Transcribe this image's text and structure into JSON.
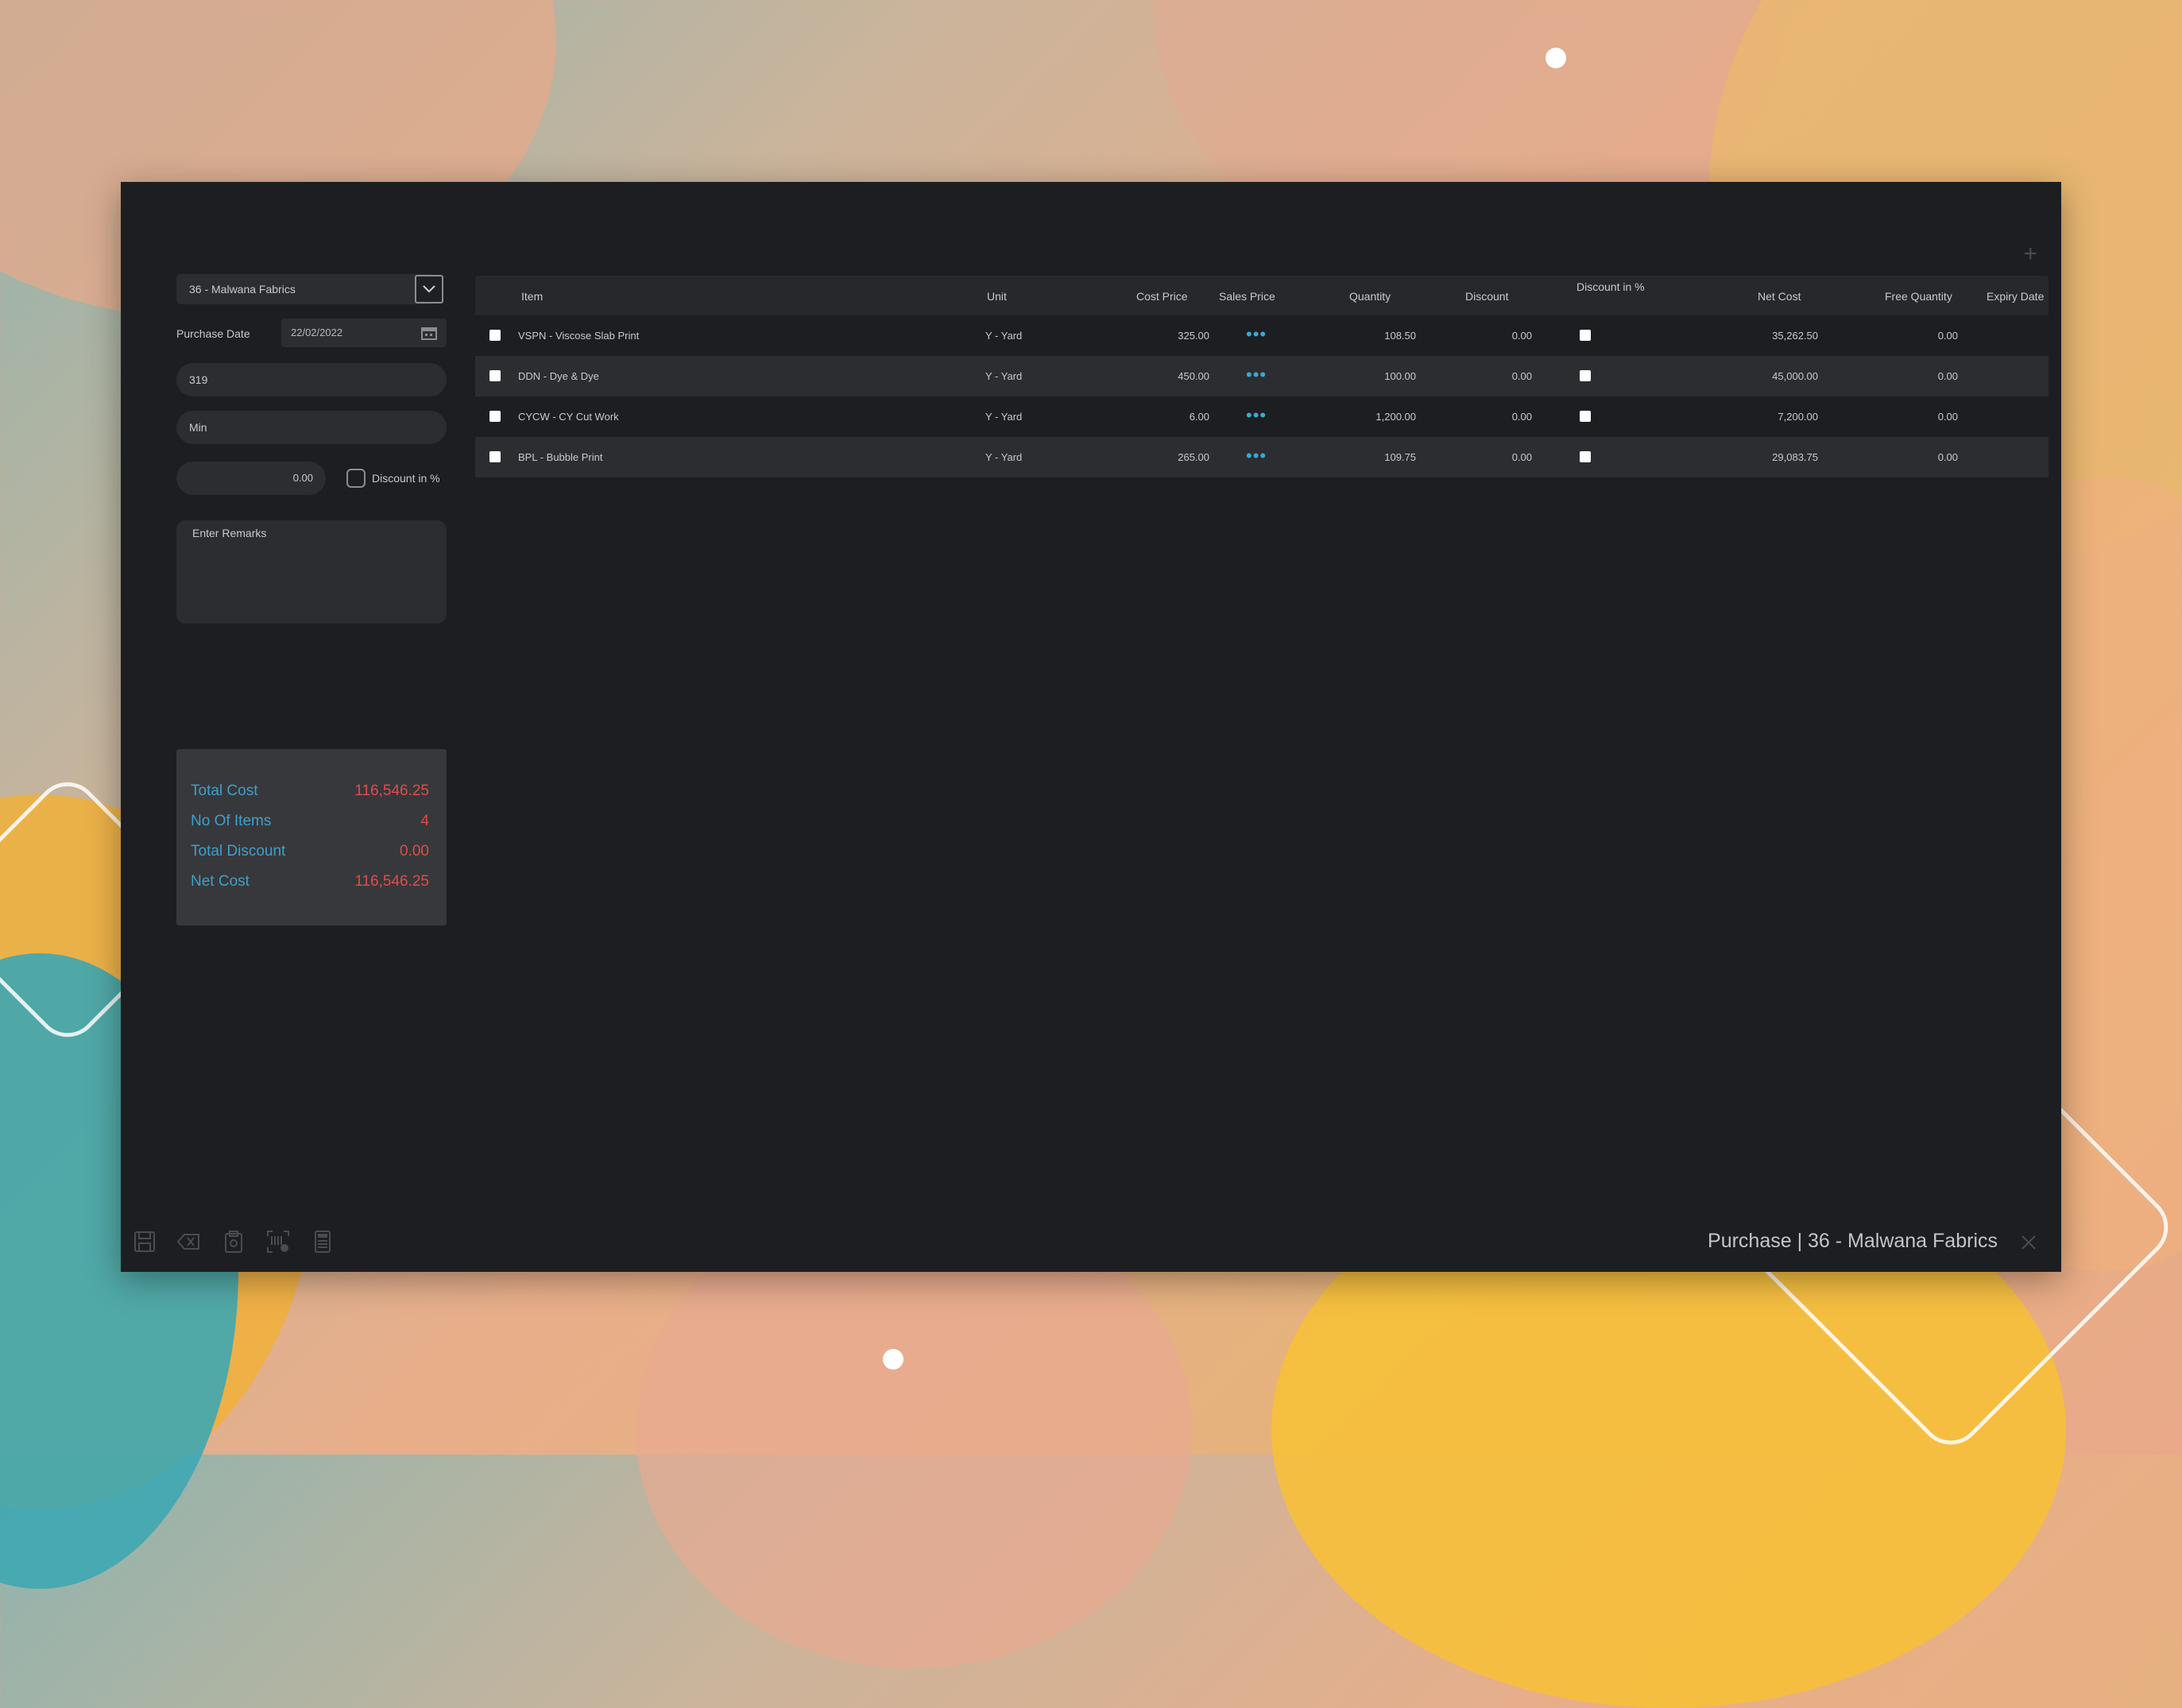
{
  "supplier": {
    "value": "36 - Malwana Fabrics"
  },
  "purchase_date": {
    "label": "Purchase Date",
    "value": "22/02/2022"
  },
  "invoice_no": {
    "value": "319"
  },
  "user": {
    "value": "Min"
  },
  "discount": {
    "value": "0.00",
    "percent_label": "Discount in %"
  },
  "remarks": {
    "placeholder": "Enter Remarks"
  },
  "summary": {
    "total_cost_label": "Total Cost",
    "total_cost": "116,546.25",
    "items_label": "No Of Items",
    "items": "4",
    "total_discount_label": "Total Discount",
    "total_discount": "0.00",
    "net_cost_label": "Net Cost",
    "net_cost": "116,546.25"
  },
  "grid": {
    "headers": {
      "item": "Item",
      "unit": "Unit",
      "cost_price": "Cost Price",
      "sales_price": "Sales Price",
      "quantity": "Quantity",
      "discount": "Discount",
      "discount_pct": "Discount in %",
      "net_cost": "Net Cost",
      "free_qty": "Free Quantity",
      "expiry": "Expiry Date"
    },
    "rows": [
      {
        "item": "VSPN - Viscose Slab Print",
        "unit": "Y - Yard",
        "cost": "325.00",
        "sales": "•••",
        "qty": "108.50",
        "discount": "0.00",
        "net": "35,262.50",
        "free": "0.00"
      },
      {
        "item": "DDN - Dye & Dye",
        "unit": "Y - Yard",
        "cost": "450.00",
        "sales": "•••",
        "qty": "100.00",
        "discount": "0.00",
        "net": "45,000.00",
        "free": "0.00"
      },
      {
        "item": "CYCW - CY Cut Work",
        "unit": "Y - Yard",
        "cost": "6.00",
        "sales": "•••",
        "qty": "1,200.00",
        "discount": "0.00",
        "net": "7,200.00",
        "free": "0.00"
      },
      {
        "item": "BPL - Bubble Print",
        "unit": "Y - Yard",
        "cost": "265.00",
        "sales": "•••",
        "qty": "109.75",
        "discount": "0.00",
        "net": "29,083.75",
        "free": "0.00"
      }
    ]
  },
  "footer": {
    "title": "Purchase | 36 - Malwana Fabrics"
  },
  "icons": [
    "save-icon",
    "clear-icon",
    "clipboard-icon",
    "scan-icon",
    "calculator-icon",
    "close-icon",
    "add-icon",
    "calendar-icon",
    "chevron-down-icon"
  ]
}
